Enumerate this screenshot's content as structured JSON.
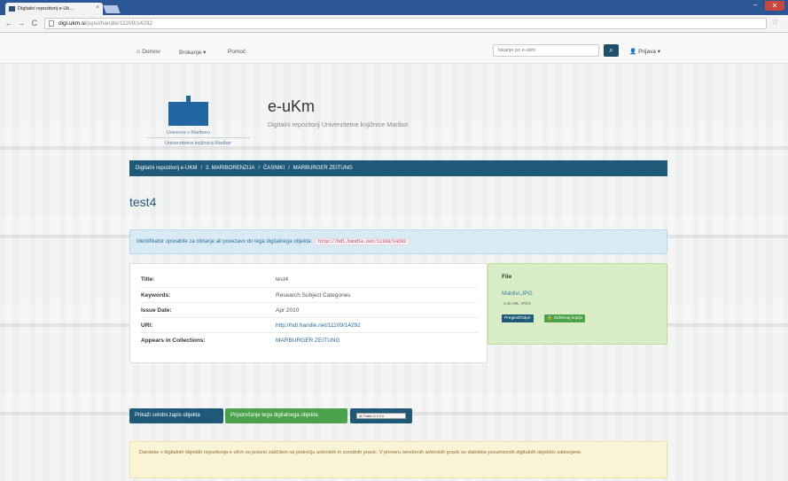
{
  "browser": {
    "tab_title": "Digitalni repozitorij e-Uk…",
    "tab_close": "×",
    "url_host": "digi.ukm.si",
    "url_path": "/jspui/handle/11109/14292"
  },
  "topnav": {
    "home": "Domov",
    "browse": "Brskanje ▾",
    "help": "Pomoč",
    "search_placeholder": "Iskanje po e-ukm",
    "login": "Prijava ▾"
  },
  "header": {
    "university": "Univerza v Mariboru",
    "library": "Univerzitetna knjižnica Maribor",
    "title": "e-uKm",
    "subtitle": "Digitalni repozitorij Univerzitetne knjižnice Maribor"
  },
  "breadcrumb": {
    "items": [
      "Digitalni repozitorij e-UKM",
      "2. MARIBORENZIJA",
      "ČASNIKI",
      "MARBURGER ZEITUNG"
    ],
    "separator": "/"
  },
  "item": {
    "title": "test4",
    "handle_notice": "Identifikator uporabite za citiranje ali povezavo do tega digitalnega objekta:",
    "handle_url": "http://hdl.handle.net/11109/14292"
  },
  "metadata": [
    {
      "label": "Title:",
      "value": "test4"
    },
    {
      "label": "Keywords:",
      "value": "Research Subject Categories"
    },
    {
      "label": "Issue Date:",
      "value": "Apr 2010"
    },
    {
      "label": "URI:",
      "value": "http://hdl.handle.net/11109/14292"
    },
    {
      "label": "Appears in Collections:",
      "value": "MARBURGER ZEITUNG"
    }
  ],
  "file_panel": {
    "heading": "File",
    "file_name": "Maldivi.JPG",
    "file_meta": "3.36 MB, JPEG",
    "view_button": "Pregled/Odpri",
    "request_button": "Zahtevaj kopijo"
  },
  "actions": {
    "show_full": "Prikaži celotni zapis objekta",
    "recommend": "Priporočanje tega digitalnega objekta",
    "altmetric": "ALT bakx ⊙ 0 0 9"
  },
  "notice": "Datoteke v digitalnih objektih repozitorija e-uKm so pravno zaščiteni na področju avtorskih in sorodnih pravic. V primeru nerešenih avtorskih pravic so datoteke posameznih digitalnih objektov zaklenjene.",
  "colors": {
    "primary": "#1e5a78",
    "success": "#4aa24a",
    "info_bg": "#d8eaf4",
    "warning_bg": "#fbf4d4",
    "file_bg": "#d8edc6"
  }
}
